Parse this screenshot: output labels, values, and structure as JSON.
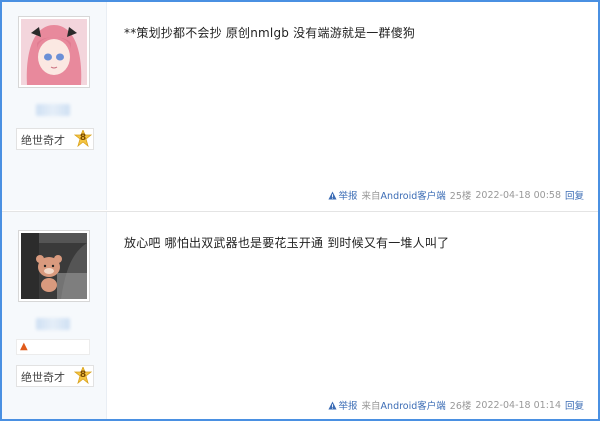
{
  "posts": [
    {
      "content": "**策划抄都不会抄 原创nmlgb 没有端游就是一群傻狗",
      "title": "绝世奇才",
      "level": "8",
      "footer": {
        "report": "举报",
        "from_prefix": "来自",
        "client": "Android客户端",
        "floor": "25楼",
        "datetime": "2022-04-18 00:58",
        "reply": "回复"
      }
    },
    {
      "content": "放心吧 哪怕出双武器也是要花玉开通 到时候又有一堆人叫了",
      "title": "绝世奇才",
      "level": "8",
      "footer": {
        "report": "举报",
        "from_prefix": "来自",
        "client": "Android客户端",
        "floor": "26楼",
        "datetime": "2022-04-18 01:14",
        "reply": "回复"
      }
    }
  ],
  "colors": {
    "border_accent": "#4a90e2",
    "link": "#3b6cb5",
    "meta": "#999999"
  },
  "icons": [
    "warning-icon",
    "level-badge-icon",
    "fire-icon"
  ]
}
